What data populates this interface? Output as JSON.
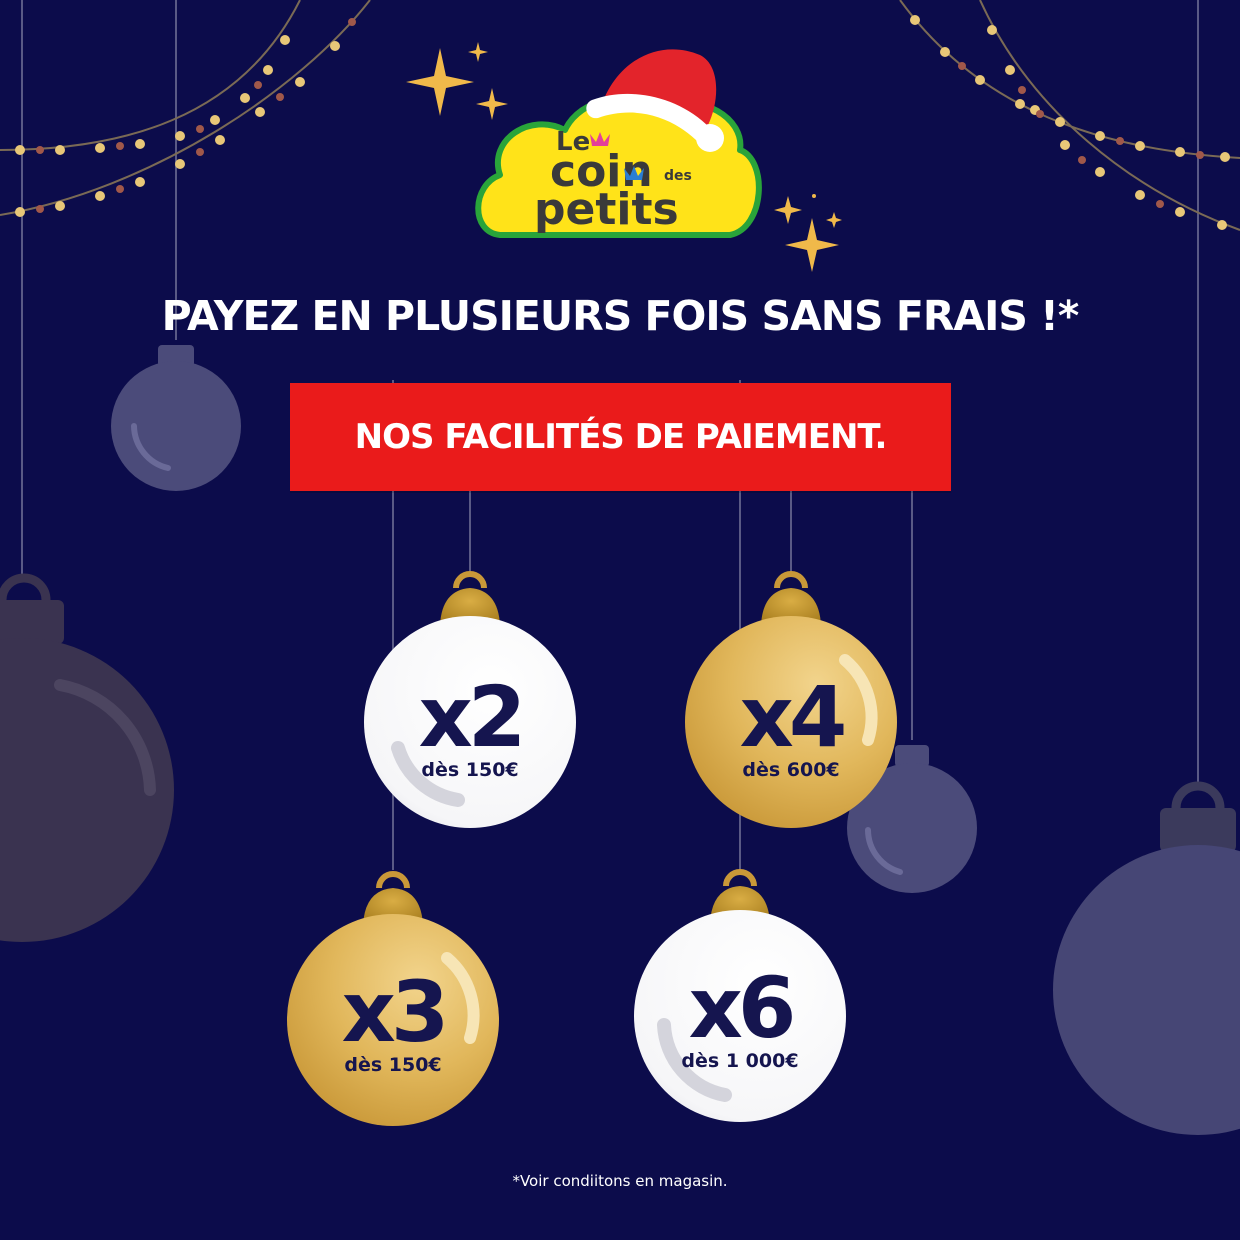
{
  "brand": {
    "logo_text": "Le coin des petits",
    "logo_parts": [
      "Le",
      "coin",
      "des",
      "petits"
    ],
    "colors": {
      "logo_yellow": "#ffe319",
      "logo_green": "#29a43a",
      "santa_red": "#e3242b"
    }
  },
  "headline": "PAYEZ EN PLUSIEURS FOIS SANS FRAIS !*",
  "banner": "NOS FACILITÉS DE PAIEMENT.",
  "options": [
    {
      "multiplier": "x2",
      "from": "dès 150€",
      "ornament_color": "white"
    },
    {
      "multiplier": "x4",
      "from": "dès 600€",
      "ornament_color": "gold"
    },
    {
      "multiplier": "x3",
      "from": "dès 150€",
      "ornament_color": "gold"
    },
    {
      "multiplier": "x6",
      "from": "dès 1 000€",
      "ornament_color": "white"
    }
  ],
  "footnote": "*Voir condiitons en magasin.",
  "colors": {
    "background": "#0c0c4b",
    "banner_red": "#ea1b1b",
    "gold": "#e1b75b",
    "white_ornament": "#ffffff",
    "text_dark": "#15154f"
  }
}
